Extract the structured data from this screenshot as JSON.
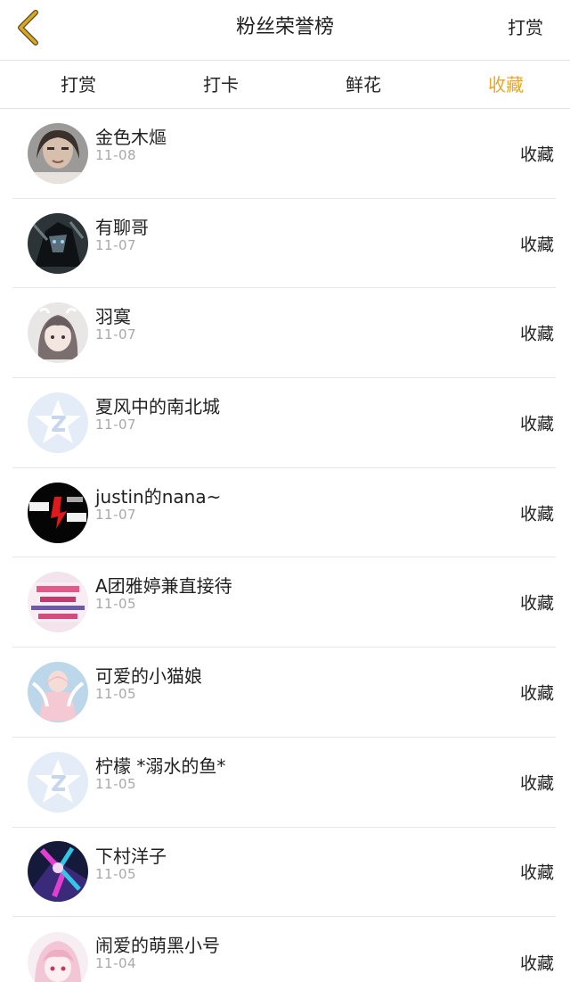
{
  "header": {
    "title": "粉丝荣誉榜",
    "action_label": "打赏"
  },
  "tabs": [
    {
      "label": "打赏",
      "active": false
    },
    {
      "label": "打卡",
      "active": false
    },
    {
      "label": "鲜花",
      "active": false
    },
    {
      "label": "收藏",
      "active": true
    }
  ],
  "colors": {
    "accent": "#e9a72a",
    "back_icon": "#d4a11e"
  },
  "fans": [
    {
      "name": "金色木熰",
      "date": "11-08",
      "action": "收藏",
      "avatar": "photo-face"
    },
    {
      "name": "有聊哥",
      "date": "11-07",
      "action": "收藏",
      "avatar": "dark-anime"
    },
    {
      "name": "羽寞",
      "date": "11-07",
      "action": "收藏",
      "avatar": "anime-girl-grey"
    },
    {
      "name": "夏风中的南北城",
      "date": "11-07",
      "action": "收藏",
      "avatar": "default-star"
    },
    {
      "name": "justin的nana~",
      "date": "11-07",
      "action": "收藏",
      "avatar": "black-logo"
    },
    {
      "name": "A团雅婷兼直接待",
      "date": "11-05",
      "action": "收藏",
      "avatar": "pink-text"
    },
    {
      "name": "可爱的小猫娘",
      "date": "11-05",
      "action": "收藏",
      "avatar": "anime-angel"
    },
    {
      "name": "柠檬 *溺水的鱼*",
      "date": "11-05",
      "action": "收藏",
      "avatar": "default-star"
    },
    {
      "name": "下村洋子",
      "date": "11-05",
      "action": "收藏",
      "avatar": "colorful-anime"
    },
    {
      "name": "闹爱的萌黑小号",
      "date": "11-04",
      "action": "收藏",
      "avatar": "pink-anime"
    }
  ]
}
